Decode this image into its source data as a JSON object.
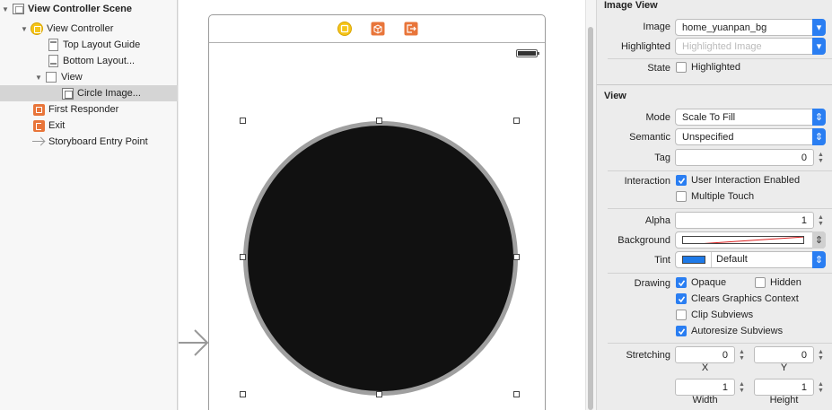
{
  "outline": {
    "items": [
      {
        "label": "View Controller Scene",
        "disclosure": "▼",
        "icon": "scene-icon"
      },
      {
        "label": "View Controller",
        "disclosure": "▼",
        "icon": "view-controller-icon"
      },
      {
        "label": "Top Layout Guide",
        "icon": "layout-guide-icon"
      },
      {
        "label": "Bottom Layout...",
        "icon": "layout-guide-icon"
      },
      {
        "label": "View",
        "disclosure": "▼",
        "icon": "view-icon"
      },
      {
        "label": "Circle Image...",
        "icon": "image-view-icon"
      },
      {
        "label": "First Responder",
        "icon": "first-responder-icon"
      },
      {
        "label": "Exit",
        "icon": "exit-icon"
      },
      {
        "label": "Storyboard Entry Point",
        "icon": "entry-point-icon"
      }
    ]
  },
  "inspector": {
    "image_view": {
      "title": "Image View",
      "image_label": "Image",
      "image_value": "home_yuanpan_bg",
      "highlighted_label": "Highlighted",
      "highlighted_placeholder": "Highlighted Image",
      "state_label": "State",
      "state_checkbox": "Highlighted"
    },
    "view": {
      "title": "View",
      "mode_label": "Mode",
      "mode_value": "Scale To Fill",
      "semantic_label": "Semantic",
      "semantic_value": "Unspecified",
      "tag_label": "Tag",
      "tag_value": "0",
      "interaction_label": "Interaction",
      "user_interaction": "User Interaction Enabled",
      "multiple_touch": "Multiple Touch",
      "alpha_label": "Alpha",
      "alpha_value": "1",
      "background_label": "Background",
      "tint_label": "Tint",
      "tint_value": "Default",
      "drawing_label": "Drawing",
      "opaque": "Opaque",
      "hidden": "Hidden",
      "clears_graphics": "Clears Graphics Context",
      "clip_subviews": "Clip Subviews",
      "autoresize_subviews": "Autoresize Subviews",
      "stretching_label": "Stretching",
      "stretch_x": "0",
      "stretch_y": "0",
      "stretch_width": "1",
      "stretch_height": "1",
      "x_label": "X",
      "y_label": "Y",
      "width_label": "Width",
      "height_label": "Height"
    }
  },
  "colors": {
    "accent": "#2a7ef2",
    "tint_swatch": "#1e7ae8",
    "view_controller_icon": "#f5c51a",
    "responder_icon": "#e8753a"
  }
}
